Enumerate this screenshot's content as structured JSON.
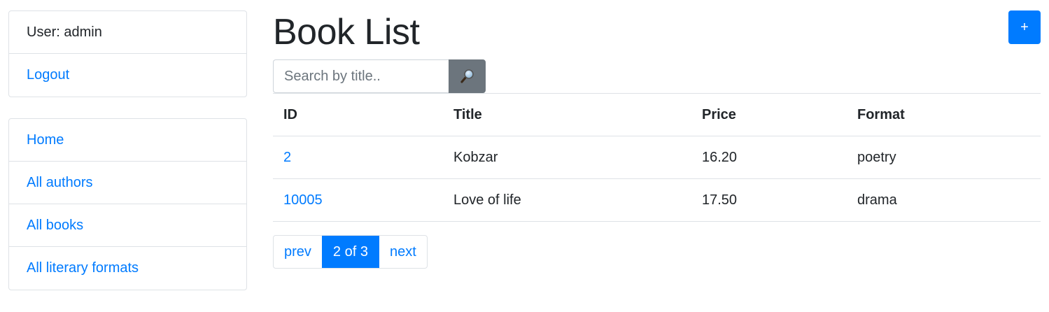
{
  "sidebar": {
    "user_label": "User: admin",
    "logout": "Logout",
    "nav": [
      {
        "label": "Home"
      },
      {
        "label": "All authors"
      },
      {
        "label": "All books"
      },
      {
        "label": "All literary formats"
      }
    ]
  },
  "header": {
    "title": "Book List",
    "add_button": "+"
  },
  "search": {
    "placeholder": "Search by title..",
    "value": "",
    "button_icon": "magnifier-icon"
  },
  "table": {
    "columns": [
      "ID",
      "Title",
      "Price",
      "Format"
    ],
    "rows": [
      {
        "id": "2",
        "title": "Kobzar",
        "price": "16.20",
        "format": "poetry"
      },
      {
        "id": "10005",
        "title": "Love of life",
        "price": "17.50",
        "format": "drama"
      }
    ]
  },
  "pagination": {
    "prev": "prev",
    "current": "2 of 3",
    "next": "next"
  },
  "colors": {
    "primary": "#007bff",
    "secondary": "#6c757d",
    "border": "#dee2e6"
  }
}
